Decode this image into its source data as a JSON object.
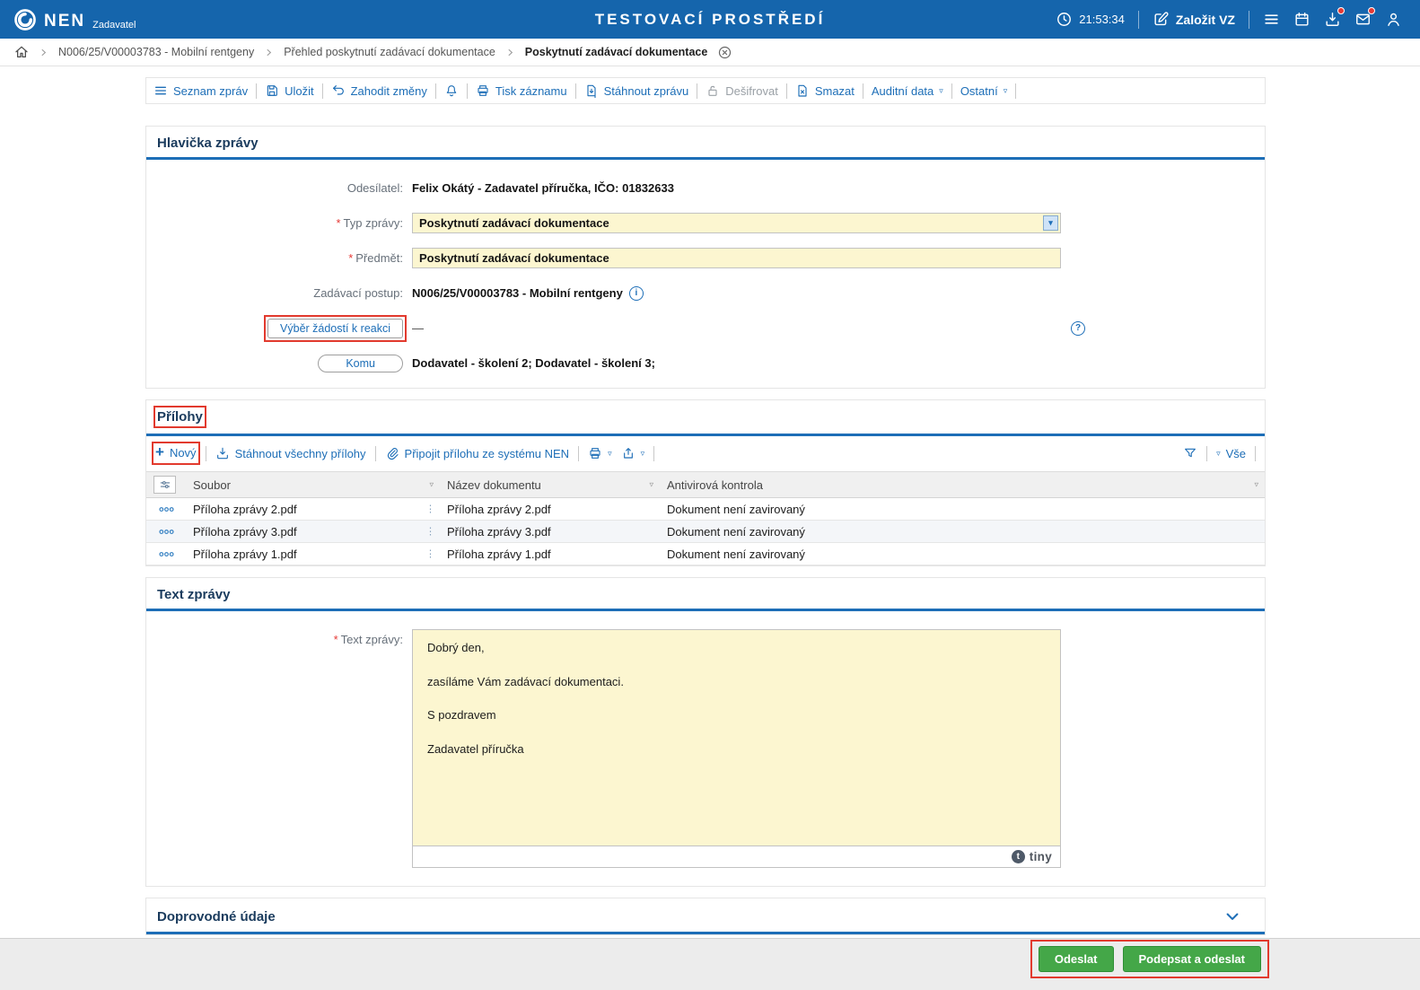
{
  "topbar": {
    "logo": "NEN",
    "logo_sub": "Zadavatel",
    "title": "TESTOVACÍ PROSTŘEDÍ",
    "time": "21:53:34",
    "create_vz_label": "Založit VZ"
  },
  "breadcrumb": {
    "items": [
      "N006/25/V00003783 - Mobilní rentgeny",
      "Přehled poskytnutí zadávací dokumentace",
      "Poskytnutí zadávací dokumentace"
    ]
  },
  "toolbar": {
    "seznam_zprav": "Seznam zpráv",
    "ulozit": "Uložit",
    "zahodit_zmeny": "Zahodit změny",
    "tisk_zaznamu": "Tisk záznamu",
    "stahnout_zpravu": "Stáhnout zprávu",
    "desifrovat": "Dešifrovat",
    "smazat": "Smazat",
    "auditni_data": "Auditní data",
    "ostatni": "Ostatní"
  },
  "header_section": {
    "title": "Hlavička zprávy",
    "fields": {
      "odesilatel": {
        "label": "Odesílatel:",
        "value": "Felix Okátý - Zadavatel příručka, IČO: 01832633"
      },
      "typ_zpravy": {
        "label": "Typ zprávy:",
        "value": "Poskytnutí zadávací dokumentace"
      },
      "predmet": {
        "label": "Předmět:",
        "value": "Poskytnutí zadávací dokumentace"
      },
      "zadavaci_postup": {
        "label": "Zadávací postup:",
        "value": "N006/25/V00003783 - Mobilní rentgeny"
      },
      "vyber_zadosti": {
        "button": "Výběr žádostí k reakci",
        "value": "—"
      },
      "komu": {
        "button": "Komu",
        "value": "Dodavatel - školení 2; Dodavatel - školení 3;"
      }
    }
  },
  "attachments": {
    "title": "Přílohy",
    "toolbar": {
      "novy": "Nový",
      "stahnout_vsechny": "Stáhnout všechny přílohy",
      "pripojit": "Připojit přílohu ze systému NEN",
      "vse": "Vše"
    },
    "columns": [
      "Soubor",
      "Název dokumentu",
      "Antivirová kontrola"
    ],
    "rows": [
      {
        "soubor": "Příloha zprávy 2.pdf",
        "nazev": "Příloha zprávy 2.pdf",
        "antivir": "Dokument není zavirovaný"
      },
      {
        "soubor": "Příloha zprávy 3.pdf",
        "nazev": "Příloha zprávy 3.pdf",
        "antivir": "Dokument není zavirovaný"
      },
      {
        "soubor": "Příloha zprávy 1.pdf",
        "nazev": "Příloha zprávy 1.pdf",
        "antivir": "Dokument není zavirovaný"
      }
    ]
  },
  "message_section": {
    "title": "Text zprávy",
    "label": "Text zprávy:",
    "text": "Dobrý den,\n\nzasíláme Vám zadávací dokumentaci.\n\nS pozdravem\n\nZadavatel příručka",
    "editor_brand": "tiny"
  },
  "accompanying_section": {
    "title": "Doprovodné údaje"
  },
  "actions": {
    "odeslat": "Odeslat",
    "podepsat_a_odeslat": "Podepsat a odeslat"
  },
  "colors": {
    "topbar_blue": "#1565ac",
    "link_blue": "#1d6eb7",
    "input_yellow": "#fcf6d0",
    "annotation_red": "#e23a2e",
    "button_green": "#44a748"
  }
}
